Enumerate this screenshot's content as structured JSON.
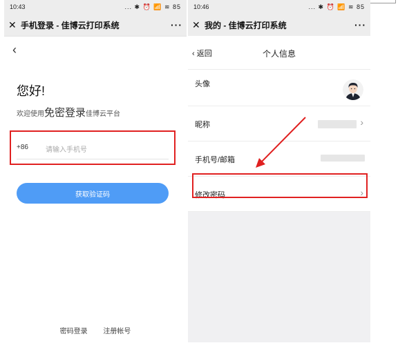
{
  "left_phone": {
    "status_time": "10:43",
    "status_icons": "... ✱ ⏰ 📶 ≋ 85",
    "title": "手机登录 - 佳博云打印系统",
    "more": "···",
    "back": "‹",
    "hello": "您好!",
    "welcome_prefix": "欢迎使用",
    "welcome_big": "免密登录",
    "welcome_suffix": "佳博云平台",
    "country_code": "+86",
    "phone_placeholder": "请输入手机号",
    "get_code_button": "获取验证码",
    "link_password_login": "密码登录",
    "link_register": "注册帐号"
  },
  "right_phone": {
    "status_time": "10:46",
    "status_icons": "... ✱ ⏰ 📶 ≋ 85",
    "title": "我的 - 佳博云打印系统",
    "more": "···",
    "back": "‹ 返回",
    "page_title": "个人信息",
    "rows": [
      {
        "label": "头像"
      },
      {
        "label": "昵称"
      },
      {
        "label": "手机号/邮箱"
      },
      {
        "label": "修改密码"
      }
    ],
    "chevron": "›"
  },
  "colors": {
    "highlight": "#e02020",
    "button": "#4f9cf6",
    "bar": "#ededed"
  }
}
